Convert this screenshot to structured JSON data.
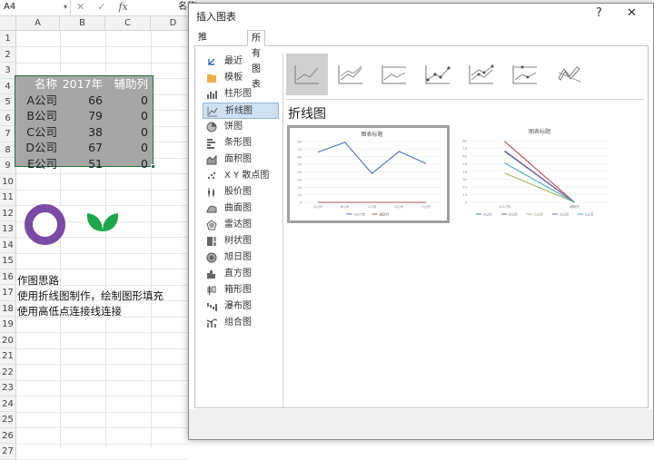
{
  "excel": {
    "name_box": "A4",
    "formula_partial": "名称",
    "columns": [
      "A",
      "B",
      "C",
      "D"
    ],
    "rows": [
      "1",
      "2",
      "3",
      "4",
      "5",
      "6",
      "7",
      "8",
      "9",
      "10",
      "11",
      "12",
      "13",
      "14",
      "15",
      "16",
      "17",
      "18",
      "19",
      "20",
      "21",
      "22",
      "23",
      "24",
      "25",
      "26",
      "27"
    ],
    "table": {
      "headers": [
        "名称",
        "2017年",
        "辅助列"
      ],
      "data": [
        [
          "A公司",
          "66",
          "0"
        ],
        [
          "B公司",
          "79",
          "0"
        ],
        [
          "C公司",
          "38",
          "0"
        ],
        [
          "D公司",
          "67",
          "0"
        ],
        [
          "E公司",
          "51",
          "0"
        ]
      ]
    },
    "notes": [
      "作图思路",
      "使用折线图制作，绘制图形填充",
      "使用高低点连接线连接"
    ],
    "colors": {
      "ring": "#7a4aa5",
      "leaf": "#1fa64a",
      "selection": "#217346"
    }
  },
  "dialog": {
    "title": "插入图表",
    "help": "?",
    "close": "✕",
    "tabs": [
      "推荐的图表",
      "所有图表"
    ],
    "categories": [
      "最近",
      "模板",
      "柱形图",
      "折线图",
      "饼图",
      "条形图",
      "面积图",
      "X Y 散点图",
      "股价图",
      "曲面图",
      "雷达图",
      "树状图",
      "旭日图",
      "直方图",
      "箱形图",
      "瀑布图",
      "组合图"
    ],
    "selected_category": "折线图",
    "section_title": "折线图",
    "preview1": {
      "title": "图表标题",
      "yticks": [
        "80",
        "70",
        "60",
        "50",
        "40",
        "30",
        "20",
        "10",
        "0"
      ],
      "xcats": [
        "A公司",
        "B公司",
        "C公司",
        "D公司",
        "E公司"
      ],
      "legend": [
        "2017年",
        "辅助列"
      ]
    },
    "preview2": {
      "title": "图表标题",
      "yticks": [
        "80",
        "70",
        "60",
        "50",
        "40",
        "30",
        "20",
        "10",
        "0"
      ],
      "xcats": [
        "2017年",
        "辅助列"
      ],
      "legend": [
        "A公司",
        "B公司",
        "C公司",
        "D公司",
        "E公司"
      ]
    }
  },
  "chart_data": [
    {
      "type": "line",
      "title": "图表标题",
      "categories": [
        "A公司",
        "B公司",
        "C公司",
        "D公司",
        "E公司"
      ],
      "series": [
        {
          "name": "2017年",
          "values": [
            66,
            79,
            38,
            67,
            51
          ],
          "color": "#4472c4"
        },
        {
          "name": "辅助列",
          "values": [
            0,
            0,
            0,
            0,
            0
          ],
          "color": "#c0504d"
        }
      ],
      "ylim": [
        0,
        80
      ]
    },
    {
      "type": "line",
      "title": "图表标题",
      "categories": [
        "2017年",
        "辅助列"
      ],
      "series": [
        {
          "name": "A公司",
          "values": [
            66,
            0
          ],
          "color": "#4472c4"
        },
        {
          "name": "B公司",
          "values": [
            79,
            0
          ],
          "color": "#c0504d"
        },
        {
          "name": "C公司",
          "values": [
            38,
            0
          ],
          "color": "#9bbb59"
        },
        {
          "name": "D公司",
          "values": [
            67,
            0
          ],
          "color": "#8064a2"
        },
        {
          "name": "E公司",
          "values": [
            51,
            0
          ],
          "color": "#4bacc6"
        }
      ],
      "ylim": [
        0,
        80
      ]
    }
  ]
}
